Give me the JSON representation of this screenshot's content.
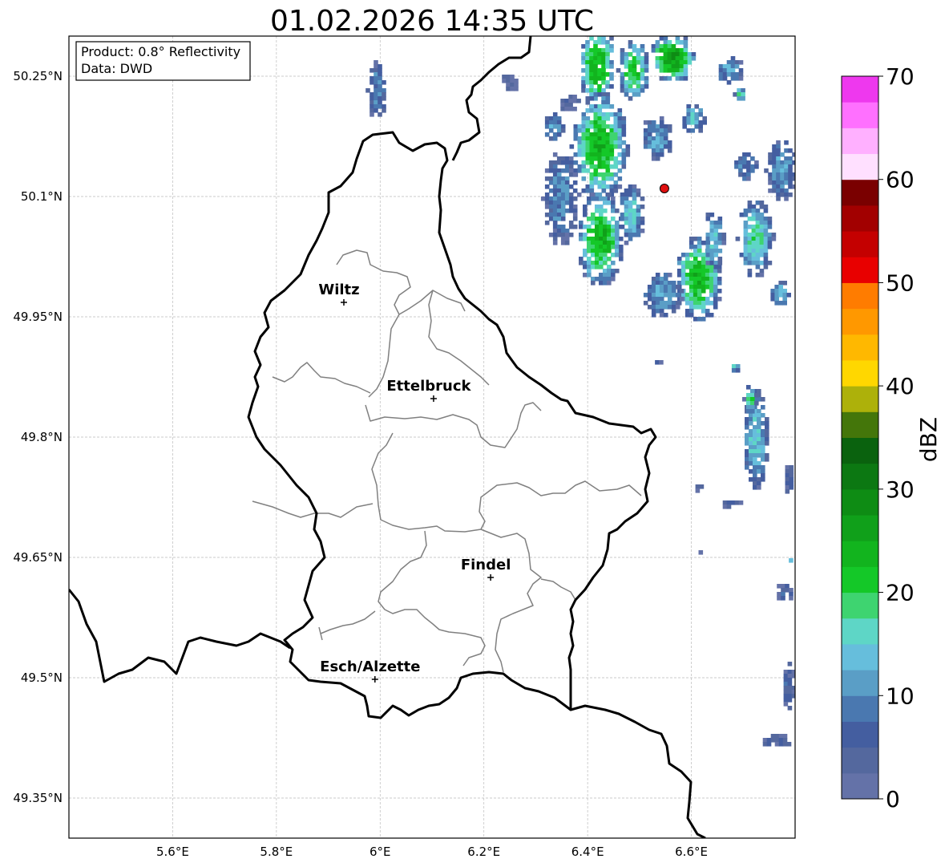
{
  "title": "01.02.2026 14:35 UTC",
  "info_box": {
    "product": "Product: 0.8° Reflectivity",
    "data": "Data: DWD"
  },
  "map": {
    "lon_range": [
      5.4,
      6.8
    ],
    "lat_range": [
      49.3,
      50.3
    ],
    "x_ticks": [
      {
        "lon": 5.6,
        "label": "5.6°E"
      },
      {
        "lon": 5.8,
        "label": "5.8°E"
      },
      {
        "lon": 6.0,
        "label": "6°E"
      },
      {
        "lon": 6.2,
        "label": "6.2°E"
      },
      {
        "lon": 6.4,
        "label": "6.4°E"
      },
      {
        "lon": 6.6,
        "label": "6.6°E"
      }
    ],
    "y_ticks": [
      {
        "lat": 50.25,
        "label": "50.25°N"
      },
      {
        "lat": 50.1,
        "label": "50.1°N"
      },
      {
        "lat": 49.95,
        "label": "49.95°N"
      },
      {
        "lat": 49.8,
        "label": "49.8°N"
      },
      {
        "lat": 49.65,
        "label": "49.65°N"
      },
      {
        "lat": 49.5,
        "label": "49.5°N"
      },
      {
        "lat": 49.35,
        "label": "49.35°N"
      }
    ],
    "cities": [
      {
        "name": "Wiltz",
        "lon": 5.93,
        "lat": 49.968
      },
      {
        "name": "Ettelbruck",
        "lon": 6.103,
        "lat": 49.848
      },
      {
        "name": "Findel",
        "lon": 6.213,
        "lat": 49.625
      },
      {
        "name": "Esch/Alzette",
        "lon": 5.99,
        "lat": 49.498
      }
    ],
    "radar_site": {
      "lon": 6.548,
      "lat": 50.11,
      "color": "#e01010"
    }
  },
  "colorbar": {
    "label": "dBZ",
    "min": 0,
    "max": 70,
    "ticks": [
      {
        "value": 0,
        "label": "0"
      },
      {
        "value": 10,
        "label": "10"
      },
      {
        "value": 20,
        "label": "20"
      },
      {
        "value": 30,
        "label": "30"
      },
      {
        "value": 40,
        "label": "40"
      },
      {
        "value": 50,
        "label": "50"
      },
      {
        "value": 60,
        "label": "60"
      },
      {
        "value": 70,
        "label": "70"
      }
    ],
    "colors": [
      "#6472a8",
      "#54689e",
      "#445ea0",
      "#4a78b0",
      "#5a9ec6",
      "#66bedc",
      "#5ed6c6",
      "#3ed470",
      "#14c828",
      "#12b41e",
      "#10a01a",
      "#0e8c14",
      "#0c7812",
      "#0a620e",
      "#44760a",
      "#adb10a",
      "#ffd700",
      "#ffb800",
      "#ff9800",
      "#ff7c00",
      "#e80000",
      "#c40000",
      "#a20000",
      "#7a0000",
      "#ffe0ff",
      "#ffb0ff",
      "#ff70ff",
      "#ee38ee"
    ]
  },
  "precip_cells": [
    {
      "lon": 6.415,
      "lat": 50.265,
      "rx": 0.035,
      "ry": 0.055,
      "dbz": 25
    },
    {
      "lon": 6.485,
      "lat": 50.26,
      "rx": 0.03,
      "ry": 0.04,
      "dbz": 22
    },
    {
      "lon": 6.56,
      "lat": 50.275,
      "rx": 0.045,
      "ry": 0.03,
      "dbz": 28
    },
    {
      "lon": 6.67,
      "lat": 50.26,
      "rx": 0.025,
      "ry": 0.02,
      "dbz": 12
    },
    {
      "lon": 6.42,
      "lat": 50.165,
      "rx": 0.055,
      "ry": 0.07,
      "dbz": 24
    },
    {
      "lon": 6.42,
      "lat": 50.05,
      "rx": 0.045,
      "ry": 0.06,
      "dbz": 24
    },
    {
      "lon": 6.345,
      "lat": 50.1,
      "rx": 0.035,
      "ry": 0.06,
      "dbz": 10
    },
    {
      "lon": 6.33,
      "lat": 50.19,
      "rx": 0.02,
      "ry": 0.02,
      "dbz": 12
    },
    {
      "lon": 6.48,
      "lat": 50.08,
      "rx": 0.025,
      "ry": 0.04,
      "dbz": 15
    },
    {
      "lon": 6.53,
      "lat": 50.175,
      "rx": 0.03,
      "ry": 0.03,
      "dbz": 12
    },
    {
      "lon": 6.6,
      "lat": 50.2,
      "rx": 0.025,
      "ry": 0.02,
      "dbz": 14
    },
    {
      "lon": 6.61,
      "lat": 50.0,
      "rx": 0.045,
      "ry": 0.055,
      "dbz": 24
    },
    {
      "lon": 6.54,
      "lat": 49.98,
      "rx": 0.04,
      "ry": 0.03,
      "dbz": 12
    },
    {
      "lon": 6.64,
      "lat": 50.05,
      "rx": 0.02,
      "ry": 0.04,
      "dbz": 15
    },
    {
      "lon": 6.72,
      "lat": 50.05,
      "rx": 0.035,
      "ry": 0.05,
      "dbz": 18
    },
    {
      "lon": 6.77,
      "lat": 50.135,
      "rx": 0.03,
      "ry": 0.04,
      "dbz": 12
    },
    {
      "lon": 6.7,
      "lat": 50.14,
      "rx": 0.025,
      "ry": 0.02,
      "dbz": 10
    },
    {
      "lon": 6.765,
      "lat": 49.98,
      "rx": 0.02,
      "ry": 0.02,
      "dbz": 14
    },
    {
      "lon": 6.69,
      "lat": 50.23,
      "rx": 0.01,
      "ry": 0.01,
      "dbz": 18
    },
    {
      "lon": 5.99,
      "lat": 50.235,
      "rx": 0.018,
      "ry": 0.04,
      "dbz": 10
    },
    {
      "lon": 6.245,
      "lat": 50.245,
      "rx": 0.018,
      "ry": 0.012,
      "dbz": 4
    },
    {
      "lon": 6.36,
      "lat": 50.22,
      "rx": 0.02,
      "ry": 0.012,
      "dbz": 4
    },
    {
      "lon": 6.72,
      "lat": 49.8,
      "rx": 0.025,
      "ry": 0.065,
      "dbz": 15
    },
    {
      "lon": 6.71,
      "lat": 49.85,
      "rx": 0.012,
      "ry": 0.02,
      "dbz": 20
    },
    {
      "lon": 6.68,
      "lat": 49.89,
      "rx": 0.01,
      "ry": 0.006,
      "dbz": 16
    },
    {
      "lon": 6.67,
      "lat": 49.72,
      "rx": 0.025,
      "ry": 0.006,
      "dbz": 6
    },
    {
      "lon": 6.61,
      "lat": 49.74,
      "rx": 0.01,
      "ry": 0.006,
      "dbz": 4
    },
    {
      "lon": 6.785,
      "lat": 49.75,
      "rx": 0.012,
      "ry": 0.02,
      "dbz": 6
    },
    {
      "lon": 6.79,
      "lat": 49.65,
      "rx": 0.01,
      "ry": 0.004,
      "dbz": 15
    },
    {
      "lon": 6.775,
      "lat": 49.61,
      "rx": 0.018,
      "ry": 0.012,
      "dbz": 6
    },
    {
      "lon": 6.785,
      "lat": 49.49,
      "rx": 0.015,
      "ry": 0.035,
      "dbz": 6
    },
    {
      "lon": 6.76,
      "lat": 49.425,
      "rx": 0.03,
      "ry": 0.01,
      "dbz": 6
    },
    {
      "lon": 6.53,
      "lat": 49.895,
      "rx": 0.008,
      "ry": 0.006,
      "dbz": 4
    },
    {
      "lon": 6.61,
      "lat": 49.66,
      "rx": 0.004,
      "ry": 0.004,
      "dbz": 4
    }
  ]
}
